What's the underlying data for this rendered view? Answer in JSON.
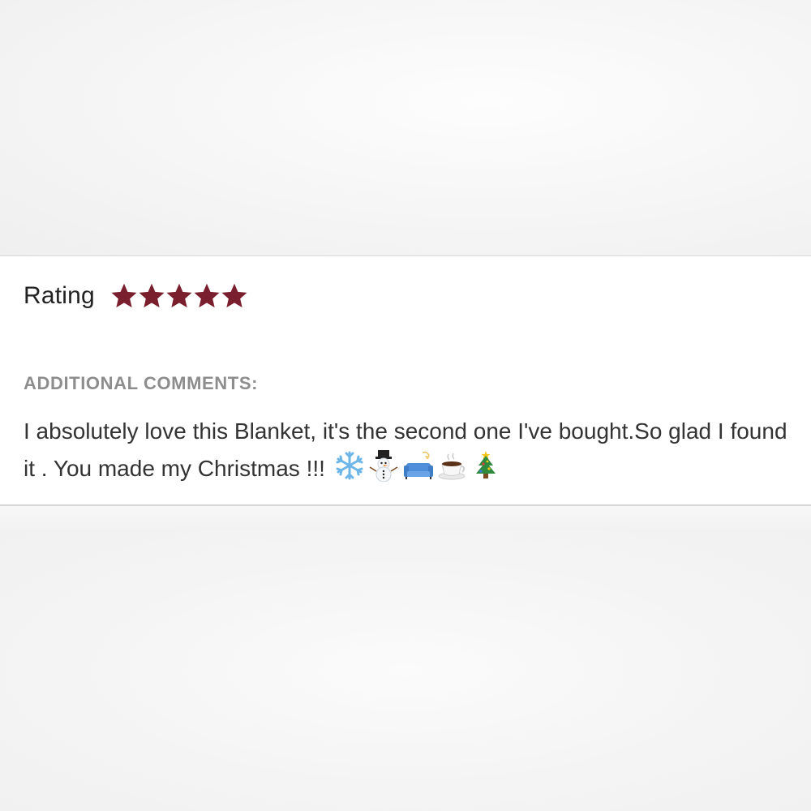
{
  "review": {
    "rating_label": "Rating",
    "rating_value": 5,
    "rating_max": 5,
    "star_color": "#7a1f2e",
    "comments_heading": "ADDITIONAL COMMENTS:",
    "comment_text": "I absolutely love this Blanket, it's the second one I've bought.So glad I found it . You made my Christmas !!!",
    "emojis": [
      "snowflake-emoji",
      "snowman-emoji",
      "couch-and-lamp-emoji",
      "hot-beverage-emoji",
      "christmas-tree-emoji"
    ]
  }
}
